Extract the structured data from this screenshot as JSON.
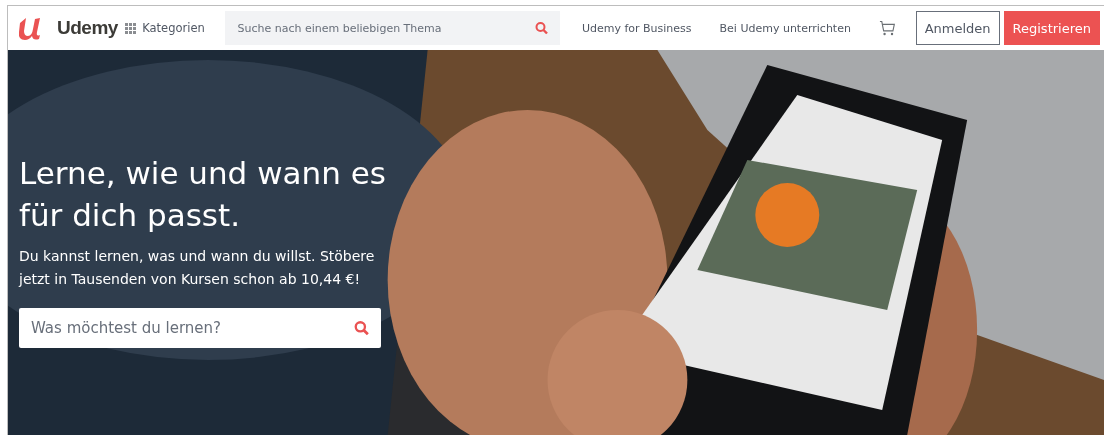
{
  "header": {
    "logo": "Udemy",
    "categories": "Kategorien",
    "search": {
      "placeholder": "Suche nach einem beliebigen Thema"
    },
    "links": [
      "Udemy for Business",
      "Bei Udemy unterrichten"
    ],
    "login": "Anmelden",
    "register": "Registrieren"
  },
  "hero": {
    "title": "Lerne, wie und wann es für dich passt.",
    "text": "Du kannst lernen, was und wann du willst. Stöbere jetzt in Tausenden von Kursen schon ab 10,44 €!",
    "search": {
      "placeholder": "Was möchtest du lernen?"
    }
  }
}
